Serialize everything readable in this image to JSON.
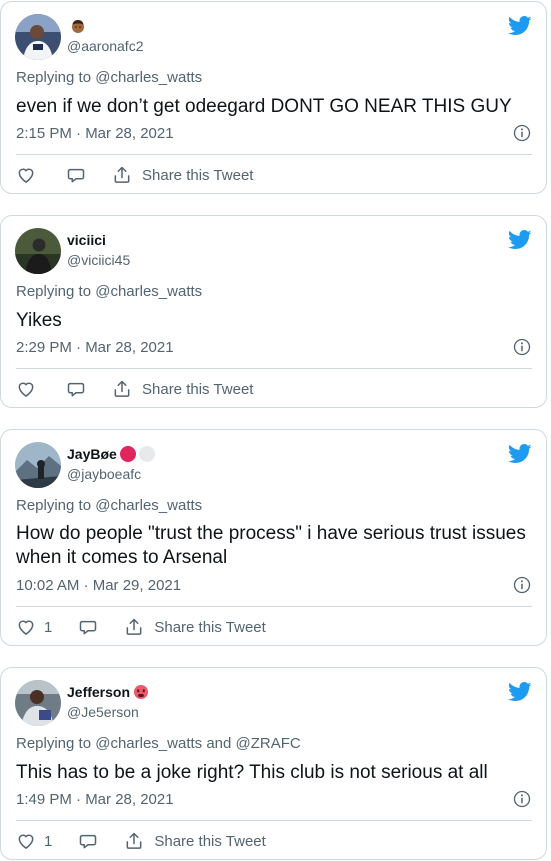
{
  "tweets": [
    {
      "name": "",
      "handle": "@aaronafc2",
      "reply_prefix": "Replying to",
      "reply_to": "@charles_watts",
      "text": "even if we don’t get odeegard DONT GO NEAR THIS GUY",
      "time": "2:15 PM · Mar 28, 2021",
      "like_count": "",
      "share_label": "Share this Tweet"
    },
    {
      "name": "viciici",
      "handle": "@viciici45",
      "reply_prefix": "Replying to",
      "reply_to": "@charles_watts",
      "text": "Yikes",
      "time": "2:29 PM · Mar 28, 2021",
      "like_count": "",
      "share_label": "Share this Tweet"
    },
    {
      "name": "JayBøe",
      "handle": "@jayboeafc",
      "reply_prefix": "Replying to",
      "reply_to": "@charles_watts",
      "text": "How do people \"trust the process\" i have serious trust issues when it comes to Arsenal",
      "time": "10:02 AM · Mar 29, 2021",
      "like_count": "1",
      "share_label": "Share this Tweet"
    },
    {
      "name": "Jefferson",
      "handle": "@Je5erson",
      "reply_prefix": "Replying to",
      "reply_to": "@charles_watts and @ZRAFC",
      "text": "This has to be a joke right? This club is not serious at all",
      "time": "1:49 PM · Mar 28, 2021",
      "like_count": "1",
      "share_label": "Share this Tweet"
    }
  ],
  "icons": {
    "brand": "twitter-bird-icon",
    "like": "heart-icon",
    "reply": "speech-bubble-icon",
    "share": "share-upload-icon",
    "info": "info-icon"
  },
  "colors": {
    "twitter_blue": "#1d9bf0",
    "secondary_text": "#536471",
    "border": "#cfd9de",
    "red_dot": "#e0245e",
    "grey_dot": "#e7e9ea"
  }
}
